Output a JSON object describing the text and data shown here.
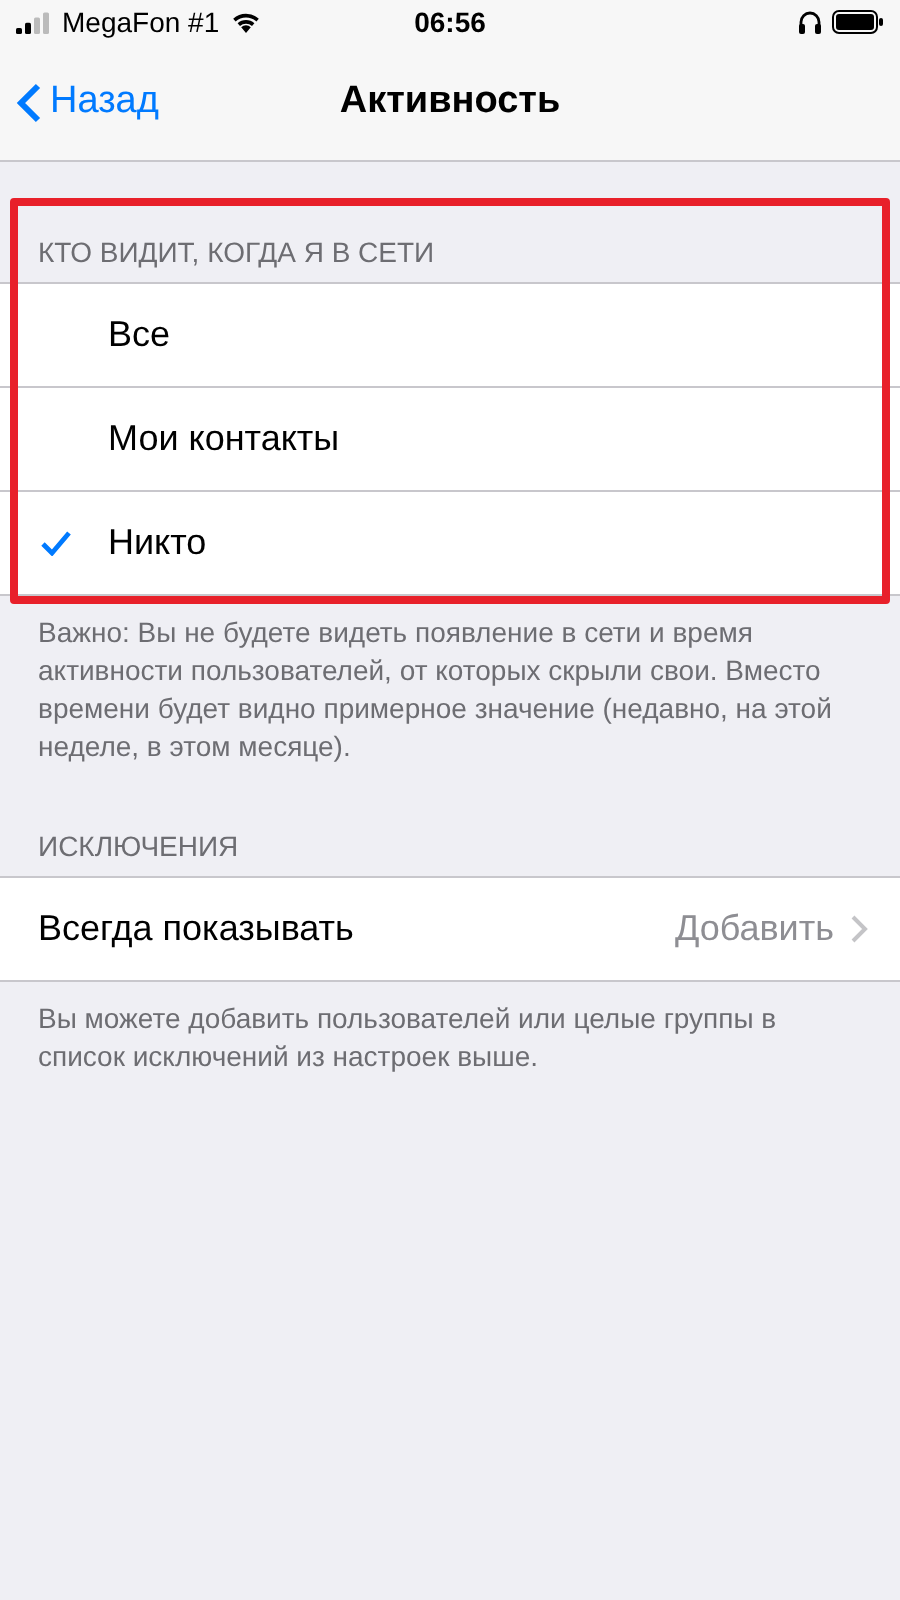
{
  "status_bar": {
    "carrier": "MegaFon #1",
    "time": "06:56"
  },
  "nav": {
    "back": "Назад",
    "title": "Активность"
  },
  "sections": [
    {
      "header": "КТО ВИДИТ, КОГДА Я В СЕТИ",
      "highlighted": true,
      "kind": "choice",
      "items": [
        {
          "label": "Все",
          "selected": false
        },
        {
          "label": "Мои контакты",
          "selected": false
        },
        {
          "label": "Никто",
          "selected": true
        }
      ],
      "footer": "Важно: Вы не будете видеть появление в сети и время активности пользователей, от которых скрыли свои. Вместо времени будет видно примерное значение (недавно, на этой неделе, в этом месяце)."
    },
    {
      "header": "ИСКЛЮЧЕНИЯ",
      "highlighted": false,
      "kind": "link",
      "items": [
        {
          "label": "Всегда показывать",
          "value": "Добавить"
        }
      ],
      "footer": "Вы можете добавить пользователей или целые группы в список исключений из настроек выше."
    }
  ]
}
